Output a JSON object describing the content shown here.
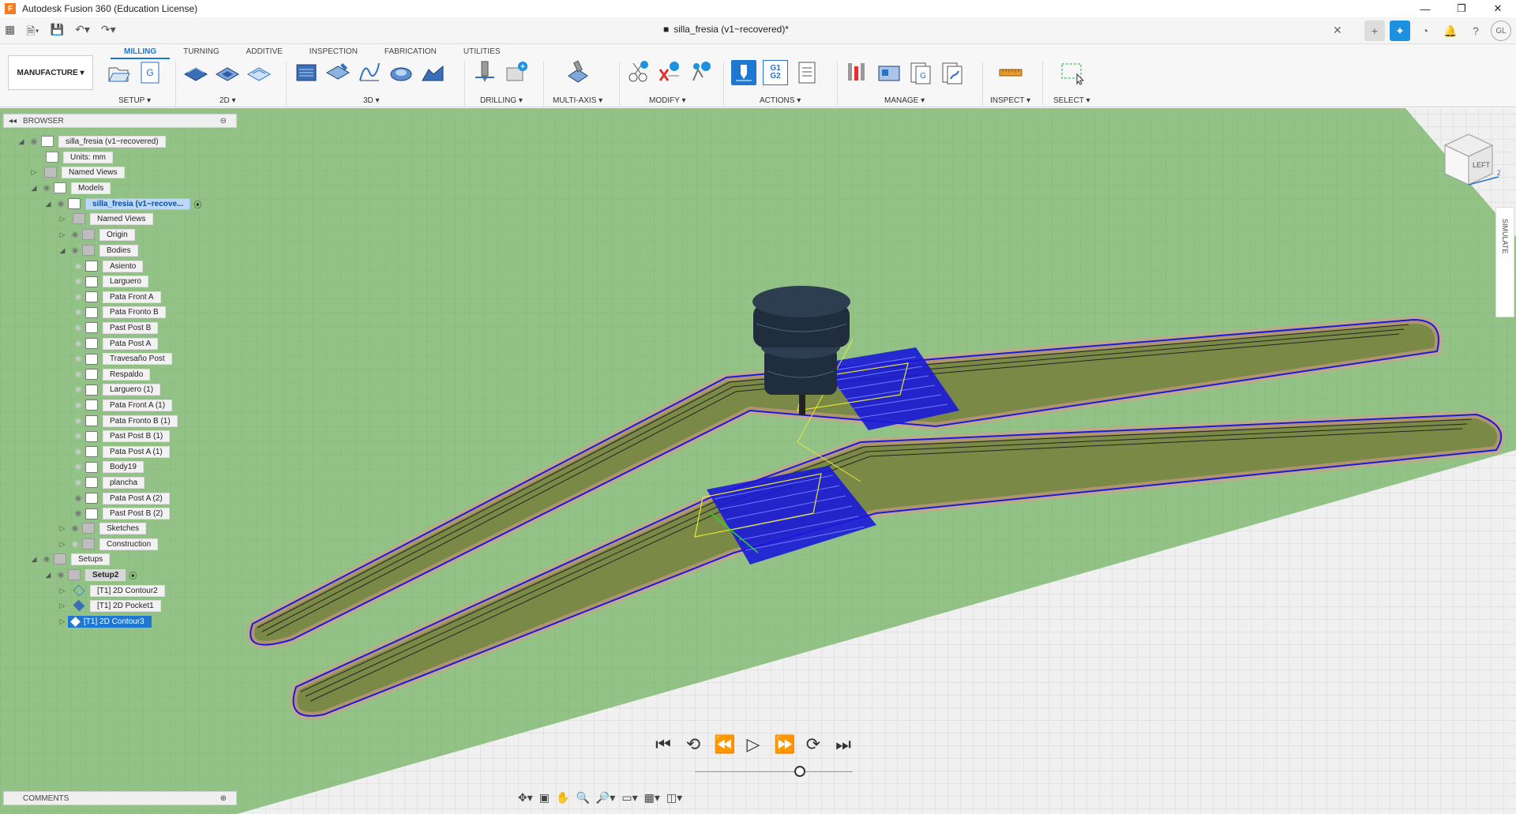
{
  "window": {
    "title": "Autodesk Fusion 360 (Education License)",
    "minimize": "—",
    "restore": "❐",
    "close": "✕"
  },
  "document": {
    "tab_title": "silla_fresia (v1~recovered)*",
    "close": "✕"
  },
  "toolbar": {
    "workspace_label": "MANUFACTURE ▾",
    "tabs": [
      "MILLING",
      "TURNING",
      "ADDITIVE",
      "INSPECTION",
      "FABRICATION",
      "UTILITIES"
    ],
    "groups": {
      "setup": "SETUP ▾",
      "g2d": "2D ▾",
      "g3d": "3D ▾",
      "drilling": "DRILLING ▾",
      "multiaxis": "MULTI-AXIS ▾",
      "modify": "MODIFY ▾",
      "actions": "ACTIONS ▾",
      "manage": "MANAGE ▾",
      "inspect": "INSPECT ▾",
      "select": "SELECT ▾"
    },
    "g1g2_label": "G1\nG2",
    "g_label": "G"
  },
  "browser": {
    "title": "BROWSER",
    "root": "silla_fresia (v1~recovered)",
    "units": "Units: mm",
    "named_views": "Named Views",
    "models": "Models",
    "model_component": "silla_fresia (v1~recove...",
    "comp_named_views": "Named Views",
    "origin": "Origin",
    "bodies": "Bodies",
    "bodies_list": [
      "Asiento",
      "Larguero",
      "Pata Front A",
      "Pata Fronto B",
      "Past Post B",
      "Pata Post A",
      "Travesaño Post",
      "Respaldo",
      "Larguero (1)",
      "Pata Front A (1)",
      "Pata Fronto B (1)",
      "Past Post B (1)",
      "Pata Post A (1)",
      "Body19",
      "plancha",
      "Pata Post A (2)",
      "Past Post B (2)"
    ],
    "sketches": "Sketches",
    "construction": "Construction",
    "setups": "Setups",
    "setup2": "Setup2",
    "operations": [
      "[T1] 2D Contour2",
      "[T1] 2D Pocket1",
      "[T1] 2D Contour3"
    ]
  },
  "comments": {
    "title": "COMMENTS"
  },
  "viewcube": {
    "face": "LEFT",
    "z_axis": "Z"
  },
  "simulate": {
    "label": "SIMULATE"
  },
  "colors": {
    "accent": "#1e78d2",
    "stock_green": "#8fbf84",
    "toolpath_blue": "#1a1ad8",
    "part_olive": "#7a8a46"
  }
}
